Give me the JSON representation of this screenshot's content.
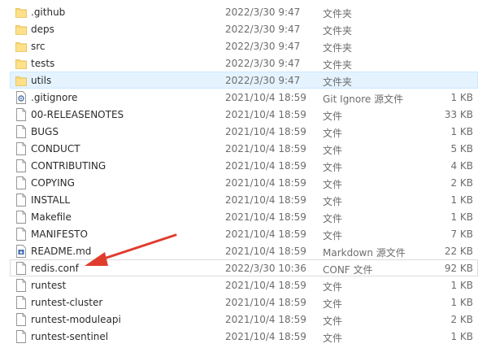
{
  "files": [
    {
      "name": ".github",
      "date": "2022/3/30 9:47",
      "type": "文件夹",
      "size": "",
      "icon": "folder-icon"
    },
    {
      "name": "deps",
      "date": "2022/3/30 9:47",
      "type": "文件夹",
      "size": "",
      "icon": "folder-icon"
    },
    {
      "name": "src",
      "date": "2022/3/30 9:47",
      "type": "文件夹",
      "size": "",
      "icon": "folder-icon"
    },
    {
      "name": "tests",
      "date": "2022/3/30 9:47",
      "type": "文件夹",
      "size": "",
      "icon": "folder-icon"
    },
    {
      "name": "utils",
      "date": "2022/3/30 9:47",
      "type": "文件夹",
      "size": "",
      "icon": "folder-icon",
      "selected": true
    },
    {
      "name": ".gitignore",
      "date": "2021/10/4 18:59",
      "type": "Git Ignore 源文件",
      "size": "1 KB",
      "icon": "gear-file-icon"
    },
    {
      "name": "00-RELEASENOTES",
      "date": "2021/10/4 18:59",
      "type": "文件",
      "size": "33 KB",
      "icon": "file-icon"
    },
    {
      "name": "BUGS",
      "date": "2021/10/4 18:59",
      "type": "文件",
      "size": "1 KB",
      "icon": "file-icon"
    },
    {
      "name": "CONDUCT",
      "date": "2021/10/4 18:59",
      "type": "文件",
      "size": "5 KB",
      "icon": "file-icon"
    },
    {
      "name": "CONTRIBUTING",
      "date": "2021/10/4 18:59",
      "type": "文件",
      "size": "4 KB",
      "icon": "file-icon"
    },
    {
      "name": "COPYING",
      "date": "2021/10/4 18:59",
      "type": "文件",
      "size": "2 KB",
      "icon": "file-icon"
    },
    {
      "name": "INSTALL",
      "date": "2021/10/4 18:59",
      "type": "文件",
      "size": "1 KB",
      "icon": "file-icon"
    },
    {
      "name": "Makefile",
      "date": "2021/10/4 18:59",
      "type": "文件",
      "size": "1 KB",
      "icon": "file-icon"
    },
    {
      "name": "MANIFESTO",
      "date": "2021/10/4 18:59",
      "type": "文件",
      "size": "7 KB",
      "icon": "file-icon"
    },
    {
      "name": "README.md",
      "date": "2021/10/4 18:59",
      "type": "Markdown 源文件",
      "size": "22 KB",
      "icon": "markdown-file-icon"
    },
    {
      "name": "redis.conf",
      "date": "2022/3/30 10:36",
      "type": "CONF 文件",
      "size": "92 KB",
      "icon": "file-icon",
      "hover": true
    },
    {
      "name": "runtest",
      "date": "2021/10/4 18:59",
      "type": "文件",
      "size": "1 KB",
      "icon": "file-icon"
    },
    {
      "name": "runtest-cluster",
      "date": "2021/10/4 18:59",
      "type": "文件",
      "size": "1 KB",
      "icon": "file-icon"
    },
    {
      "name": "runtest-moduleapi",
      "date": "2021/10/4 18:59",
      "type": "文件",
      "size": "2 KB",
      "icon": "file-icon"
    },
    {
      "name": "runtest-sentinel",
      "date": "2021/10/4 18:59",
      "type": "文件",
      "size": "1 KB",
      "icon": "file-icon"
    }
  ],
  "annotation": {
    "icon": "red-arrow-icon",
    "color": "#e03c2e"
  }
}
